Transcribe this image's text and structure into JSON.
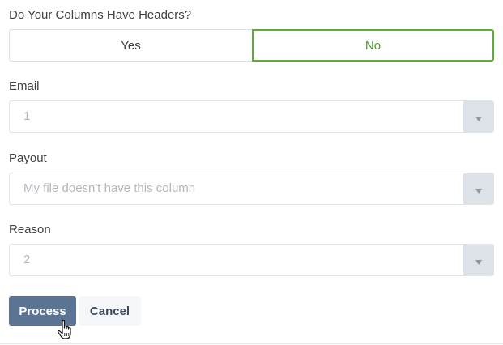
{
  "headers_question": {
    "label": "Do Your Columns Have Headers?",
    "options": [
      "Yes",
      "No"
    ],
    "selected": "No"
  },
  "fields": {
    "email": {
      "label": "Email",
      "value": "1"
    },
    "payout": {
      "label": "Payout",
      "value": "My file doesn't have this column"
    },
    "reason": {
      "label": "Reason",
      "value": "2"
    }
  },
  "actions": {
    "process_label": "Process",
    "cancel_label": "Cancel"
  },
  "colors": {
    "selected_border": "#5cad3a",
    "primary_button": "#5c7494",
    "select_arrow_bg": "#dde1e8"
  },
  "icons": {
    "dropdown": "chevron-down-icon",
    "cursor": "hand-pointer-cursor-icon"
  }
}
